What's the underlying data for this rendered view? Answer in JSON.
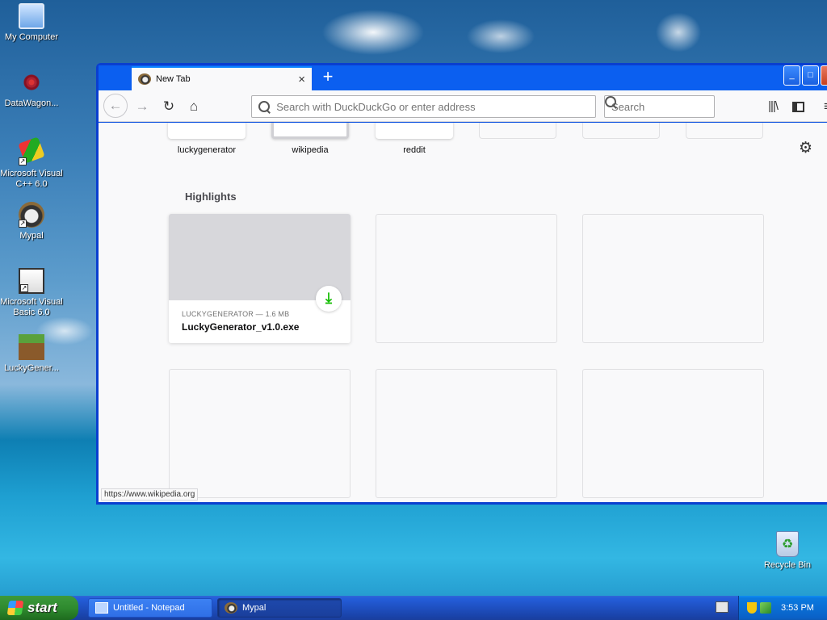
{
  "desktop": {
    "icons": [
      {
        "label": "My Computer"
      },
      {
        "label": "DataWagon..."
      },
      {
        "label": "Microsoft Visual C++ 6.0"
      },
      {
        "label": "Mypal"
      },
      {
        "label": "Microsoft Visual Basic 6.0"
      },
      {
        "label": "LuckyGener..."
      },
      {
        "label": "Recycle Bin"
      }
    ]
  },
  "browser": {
    "tab": {
      "title": "New Tab",
      "close": "×"
    },
    "new_tab": "+",
    "window_buttons": {
      "minimize": "_",
      "maximize": "□"
    },
    "nav": {
      "back": "←",
      "forward": "→",
      "reload": "↻",
      "home": "⌂",
      "library": "|||\\",
      "menu": "≡"
    },
    "url_placeholder": "Search with DuckDuckGo or enter address",
    "search_placeholder": "Search",
    "top_sites": [
      {
        "label": "luckygenerator"
      },
      {
        "label": "wikipedia"
      },
      {
        "label": "reddit"
      }
    ],
    "settings_glyph": "⚙",
    "highlights": {
      "title": "Highlights",
      "cards": [
        {
          "context": "LUCKYGENERATOR — 1.6 MB",
          "filename": "LuckyGenerator_v1.0.exe",
          "badge": "⤓"
        }
      ]
    },
    "status_url": "https://www.wikipedia.org"
  },
  "taskbar": {
    "start": "start",
    "tasks": [
      {
        "label": "Untitled - Notepad"
      },
      {
        "label": "Mypal"
      }
    ],
    "clock": "3:53 PM"
  }
}
